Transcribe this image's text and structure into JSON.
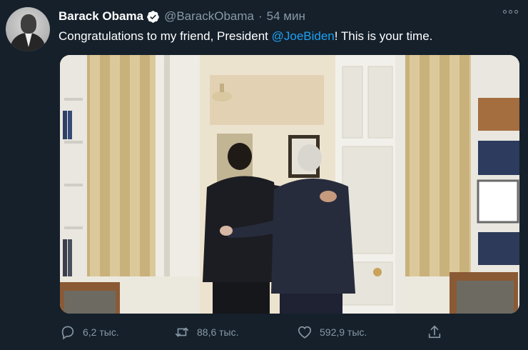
{
  "author": {
    "name": "Barack Obama",
    "handle": "@BarackObama",
    "separator": "·",
    "time": "54 мин"
  },
  "tweet": {
    "text_before": "Congratulations to my friend, President ",
    "mention": "@JoeBiden",
    "text_after": "! This is your time."
  },
  "stats": {
    "replies": "6,2 тыс.",
    "retweets": "88,6 тыс.",
    "likes": "592,9 тыс."
  },
  "icons": {
    "verified": "verified-badge-icon",
    "more": "more-options-icon",
    "reply": "reply-icon",
    "retweet": "retweet-icon",
    "like": "heart-icon",
    "share": "share-icon"
  },
  "colors": {
    "background": "#15202b",
    "text": "#ffffff",
    "secondary": "#8899a6",
    "accent": "#1da1f2"
  }
}
